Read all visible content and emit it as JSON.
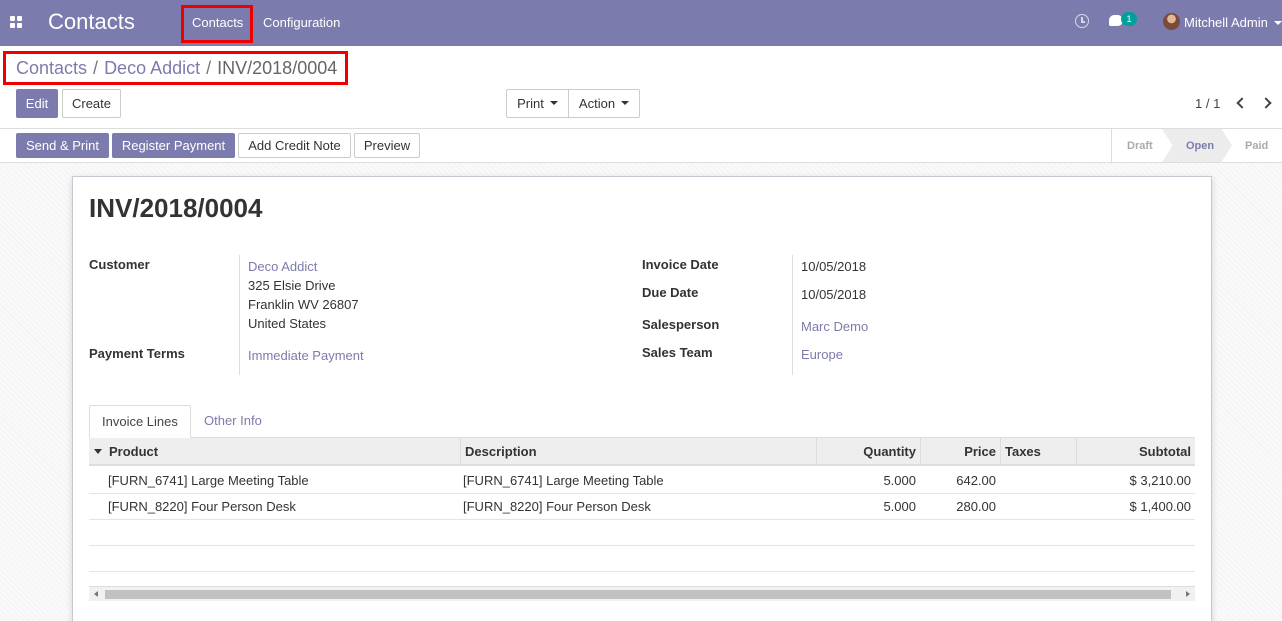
{
  "navbar": {
    "app_title": "Contacts",
    "menu": [
      "Contacts",
      "Configuration"
    ],
    "chat_badge": "1",
    "user_name": "Mitchell Admin"
  },
  "breadcrumb": [
    "Contacts",
    "Deco Addict",
    "INV/2018/0004"
  ],
  "buttons": {
    "edit": "Edit",
    "create": "Create",
    "print": "Print",
    "action": "Action",
    "send_print": "Send & Print",
    "register_payment": "Register Payment",
    "add_credit_note": "Add Credit Note",
    "preview": "Preview"
  },
  "pager": "1 / 1",
  "status": {
    "stages": [
      "Draft",
      "Open",
      "Paid"
    ],
    "current": "Open"
  },
  "invoice": {
    "number": "INV/2018/0004",
    "customer_label": "Customer",
    "customer_name": "Deco Addict",
    "address": [
      "325 Elsie Drive",
      "Franklin WV 26807",
      "United States"
    ],
    "payment_terms_label": "Payment Terms",
    "payment_terms": "Immediate Payment",
    "invoice_date_label": "Invoice Date",
    "invoice_date": "10/05/2018",
    "due_date_label": "Due Date",
    "due_date": "10/05/2018",
    "salesperson_label": "Salesperson",
    "salesperson": "Marc Demo",
    "sales_team_label": "Sales Team",
    "sales_team": "Europe"
  },
  "tabs": [
    "Invoice Lines",
    "Other Info"
  ],
  "table": {
    "columns": [
      "Product",
      "Description",
      "Quantity",
      "Price",
      "Taxes",
      "Subtotal"
    ],
    "rows": [
      {
        "product": "[FURN_6741] Large Meeting Table",
        "description": "[FURN_6741] Large Meeting Table",
        "quantity": "5.000",
        "price": "642.00",
        "taxes": "",
        "subtotal": "$ 3,210.00"
      },
      {
        "product": "[FURN_8220] Four Person Desk",
        "description": "[FURN_8220] Four Person Desk",
        "quantity": "5.000",
        "price": "280.00",
        "taxes": "",
        "subtotal": "$ 1,400.00"
      }
    ]
  },
  "colors": {
    "brand": "#7c7bad",
    "highlight": "#e00000",
    "badge": "#00a09d"
  }
}
